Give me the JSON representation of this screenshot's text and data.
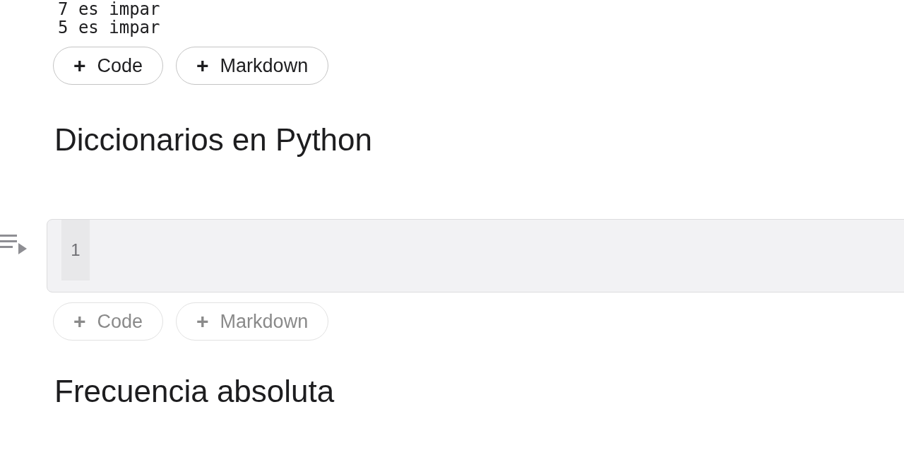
{
  "output_lines": [
    "7 es impar",
    "5 es impar"
  ],
  "cells": [
    {
      "kind": "add_row",
      "dimmed": false,
      "buttons": [
        {
          "icon": "+",
          "label": "Code"
        },
        {
          "icon": "+",
          "label": "Markdown"
        }
      ]
    },
    {
      "kind": "heading",
      "text": "Diccionarios en Python"
    },
    {
      "kind": "code",
      "line_numbers": [
        "1"
      ]
    },
    {
      "kind": "add_row",
      "dimmed": true,
      "buttons": [
        {
          "icon": "+",
          "label": "Code"
        },
        {
          "icon": "+",
          "label": "Markdown"
        }
      ]
    },
    {
      "kind": "heading",
      "text": "Frecuencia absoluta"
    }
  ]
}
